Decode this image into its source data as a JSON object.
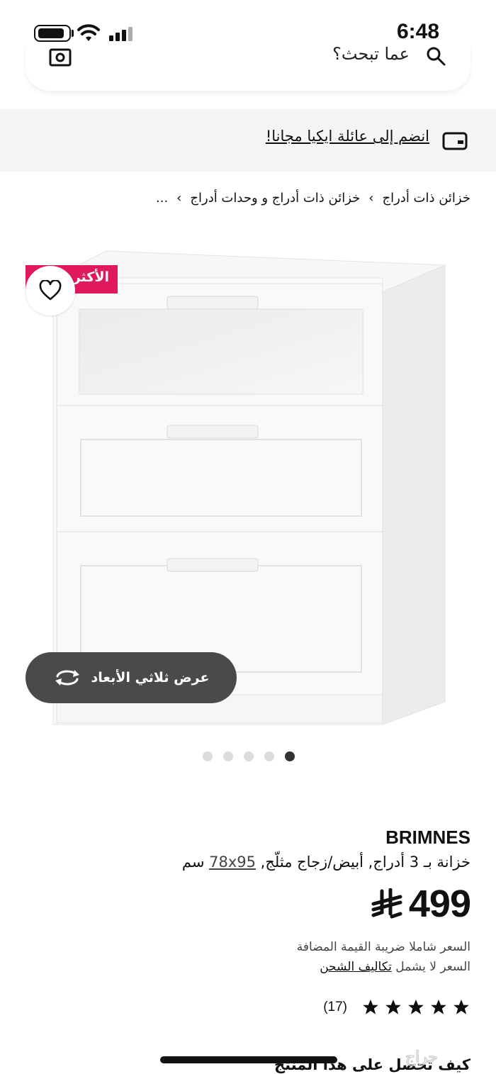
{
  "status_bar": {
    "time": "6:48"
  },
  "search": {
    "placeholder": "عما تبحث؟",
    "icons": [
      "camera-icon",
      "search-icon"
    ]
  },
  "family_banner": {
    "text": "انضم إلى عائلة ايكيا مجانا!",
    "icon": "loyalty-card-icon"
  },
  "breadcrumb": {
    "items": [
      "...",
      "خزائن ذات أدراج و وحدات أدراج",
      "خزائن ذات أدراج"
    ],
    "separator": "›"
  },
  "product_image": {
    "badge": "الأكثر",
    "view_3d_label": "عرض ثلاثي الأبعاد",
    "dots_total": 5,
    "active_dot": 1
  },
  "product": {
    "name": "BRIMNES",
    "description": "خزانة بـ 3 أدراج, أبيض/زجاج مثلّج,",
    "dimensions": "78x95",
    "unit": "سم",
    "price": "499",
    "currency_symbol": "riyal-sign-icon",
    "vat_note": "السعر شاملا ضريبة القيمة المضافة",
    "shipping_prefix": "السعر لا يشمل",
    "shipping_link": "تكاليف الشحن",
    "rating_stars": 5,
    "review_count": "(17)",
    "how_to_get": "كيف تحصل على هذا المنتج"
  },
  "colors": {
    "badge": "#e0195c",
    "banner_bg": "#f5f5f5",
    "button_3d_bg": "#4a4a4a"
  },
  "watermark": "حراج"
}
